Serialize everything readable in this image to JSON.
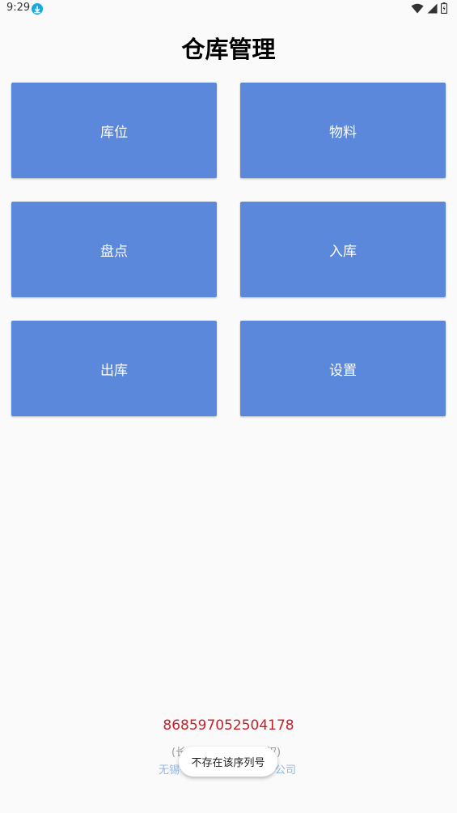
{
  "status_bar": {
    "time": "9:29"
  },
  "title": "仓库管理",
  "tiles": [
    {
      "label": "库位"
    },
    {
      "label": "物料"
    },
    {
      "label": "盘点"
    },
    {
      "label": "入库"
    },
    {
      "label": "出库"
    },
    {
      "label": "设置"
    }
  ],
  "footer": {
    "serial": "868597052504178",
    "line1_left": "(长",
    "line1_right": "权)",
    "line2_left": "无锡",
    "line2_right": "公司"
  },
  "toast": {
    "message": "不存在该序列号"
  },
  "colors": {
    "tile": "#5b88db",
    "serial": "#c81e2a",
    "background": "#fafafa"
  }
}
